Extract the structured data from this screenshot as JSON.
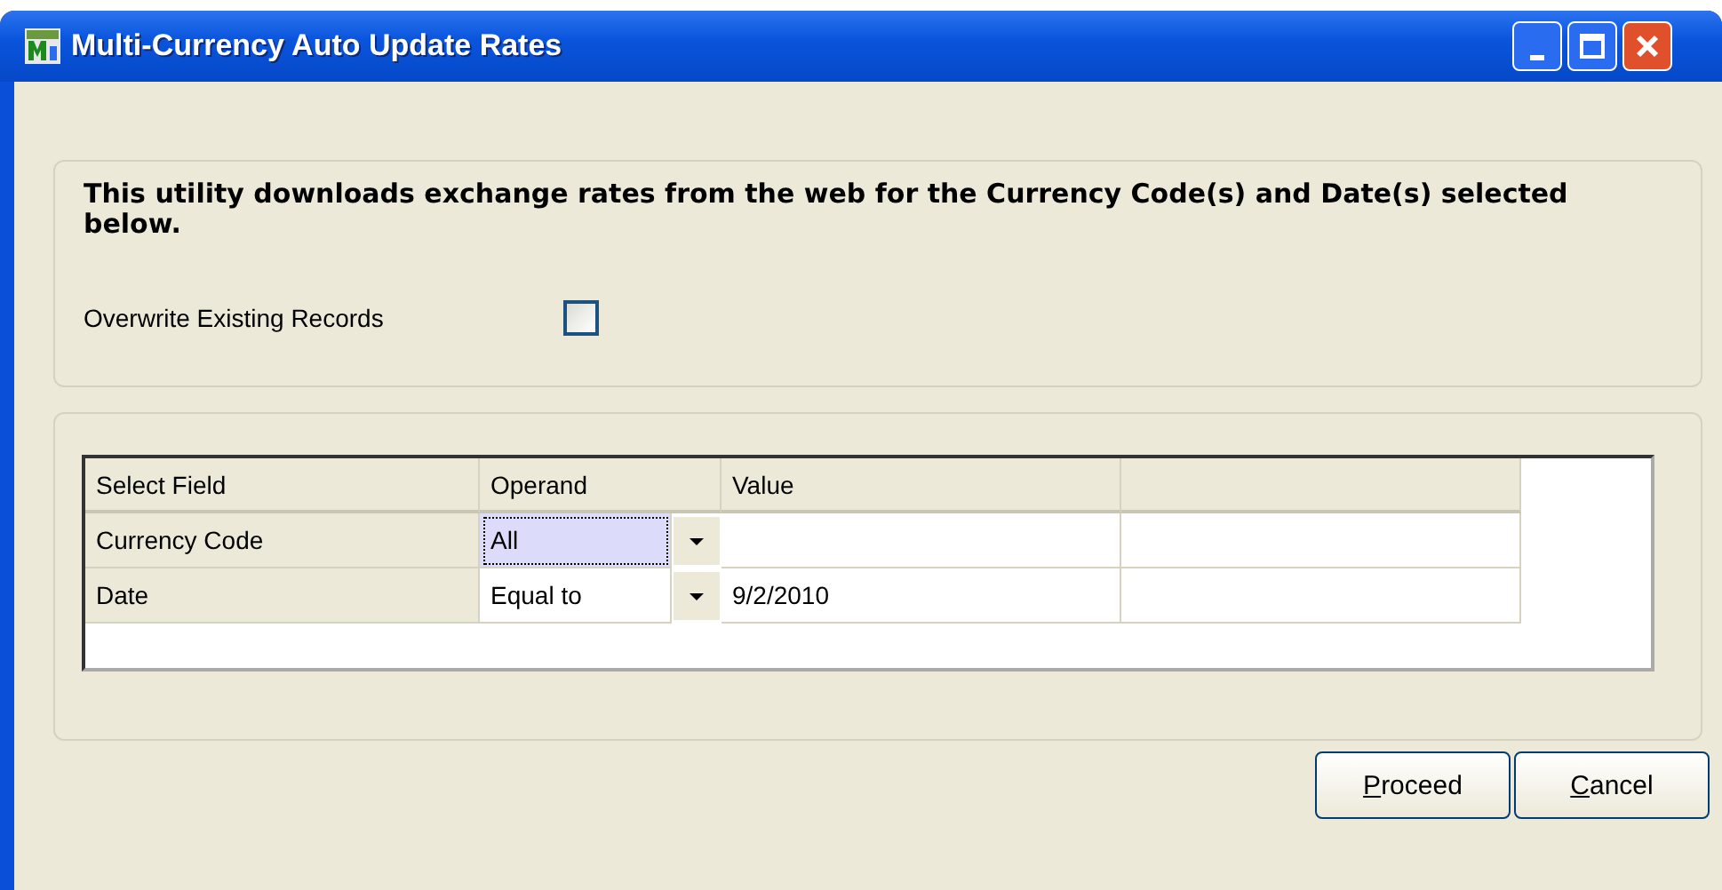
{
  "window": {
    "title": "Multi-Currency Auto Update Rates"
  },
  "intro": "This utility downloads exchange rates from the web for the Currency Code(s) and Date(s) selected below.",
  "overwrite": {
    "label": "Overwrite Existing Records",
    "checked": false
  },
  "grid": {
    "columns": [
      "Select Field",
      "Operand",
      "Value"
    ],
    "rows": [
      {
        "field": "Currency Code",
        "operand": "All",
        "selected": true,
        "value": ""
      },
      {
        "field": "Date",
        "operand": "Equal to",
        "selected": false,
        "value": "9/2/2010"
      }
    ]
  },
  "buttons": [
    {
      "label": "Proceed"
    },
    {
      "label": "Cancel"
    }
  ]
}
